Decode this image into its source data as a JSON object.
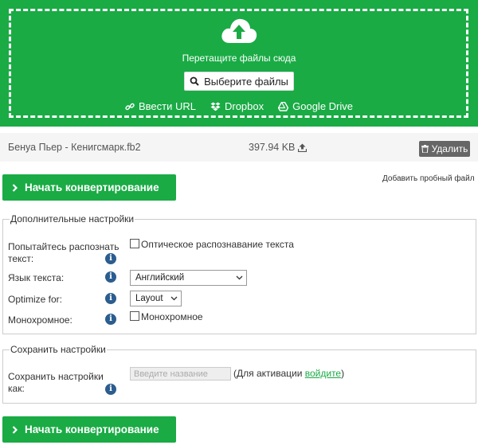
{
  "dropzone": {
    "prompt": "Перетащите файлы сюда",
    "choose_label": "Выберите файлы",
    "url_label": "Ввести URL",
    "dropbox_label": "Dropbox",
    "gdrive_label": "Google Drive"
  },
  "file": {
    "name": "Бенуа Пьер - Кенигсмарк.fb2",
    "size": "397.94 KB",
    "delete_label": "Удалить"
  },
  "actions": {
    "start_label": "Начать конвертирование",
    "sample_label": "Добавить пробный файл"
  },
  "advanced": {
    "legend": "Дополнительные настройки",
    "ocr_label": "Попытайтесь распознать текст:",
    "ocr_checkbox_label": "Оптическое распознавание текста",
    "ocr_checked": false,
    "lang_label": "Язык текста:",
    "lang_value": "Английский",
    "optimize_label": "Optimize for:",
    "optimize_value": "Layout",
    "mono_label": "Монохромное:",
    "mono_checkbox_label": "Монохромное",
    "mono_checked": false
  },
  "save": {
    "legend": "Сохранить настройки",
    "label": "Сохранить настройки как:",
    "placeholder": "Введите название",
    "activation_prefix": "(Для активации ",
    "activation_link": "войдите",
    "activation_suffix": ")"
  },
  "colors": {
    "brand_green": "#1aab45",
    "info_blue": "#2b5d8f",
    "delete_gray": "#666666"
  }
}
